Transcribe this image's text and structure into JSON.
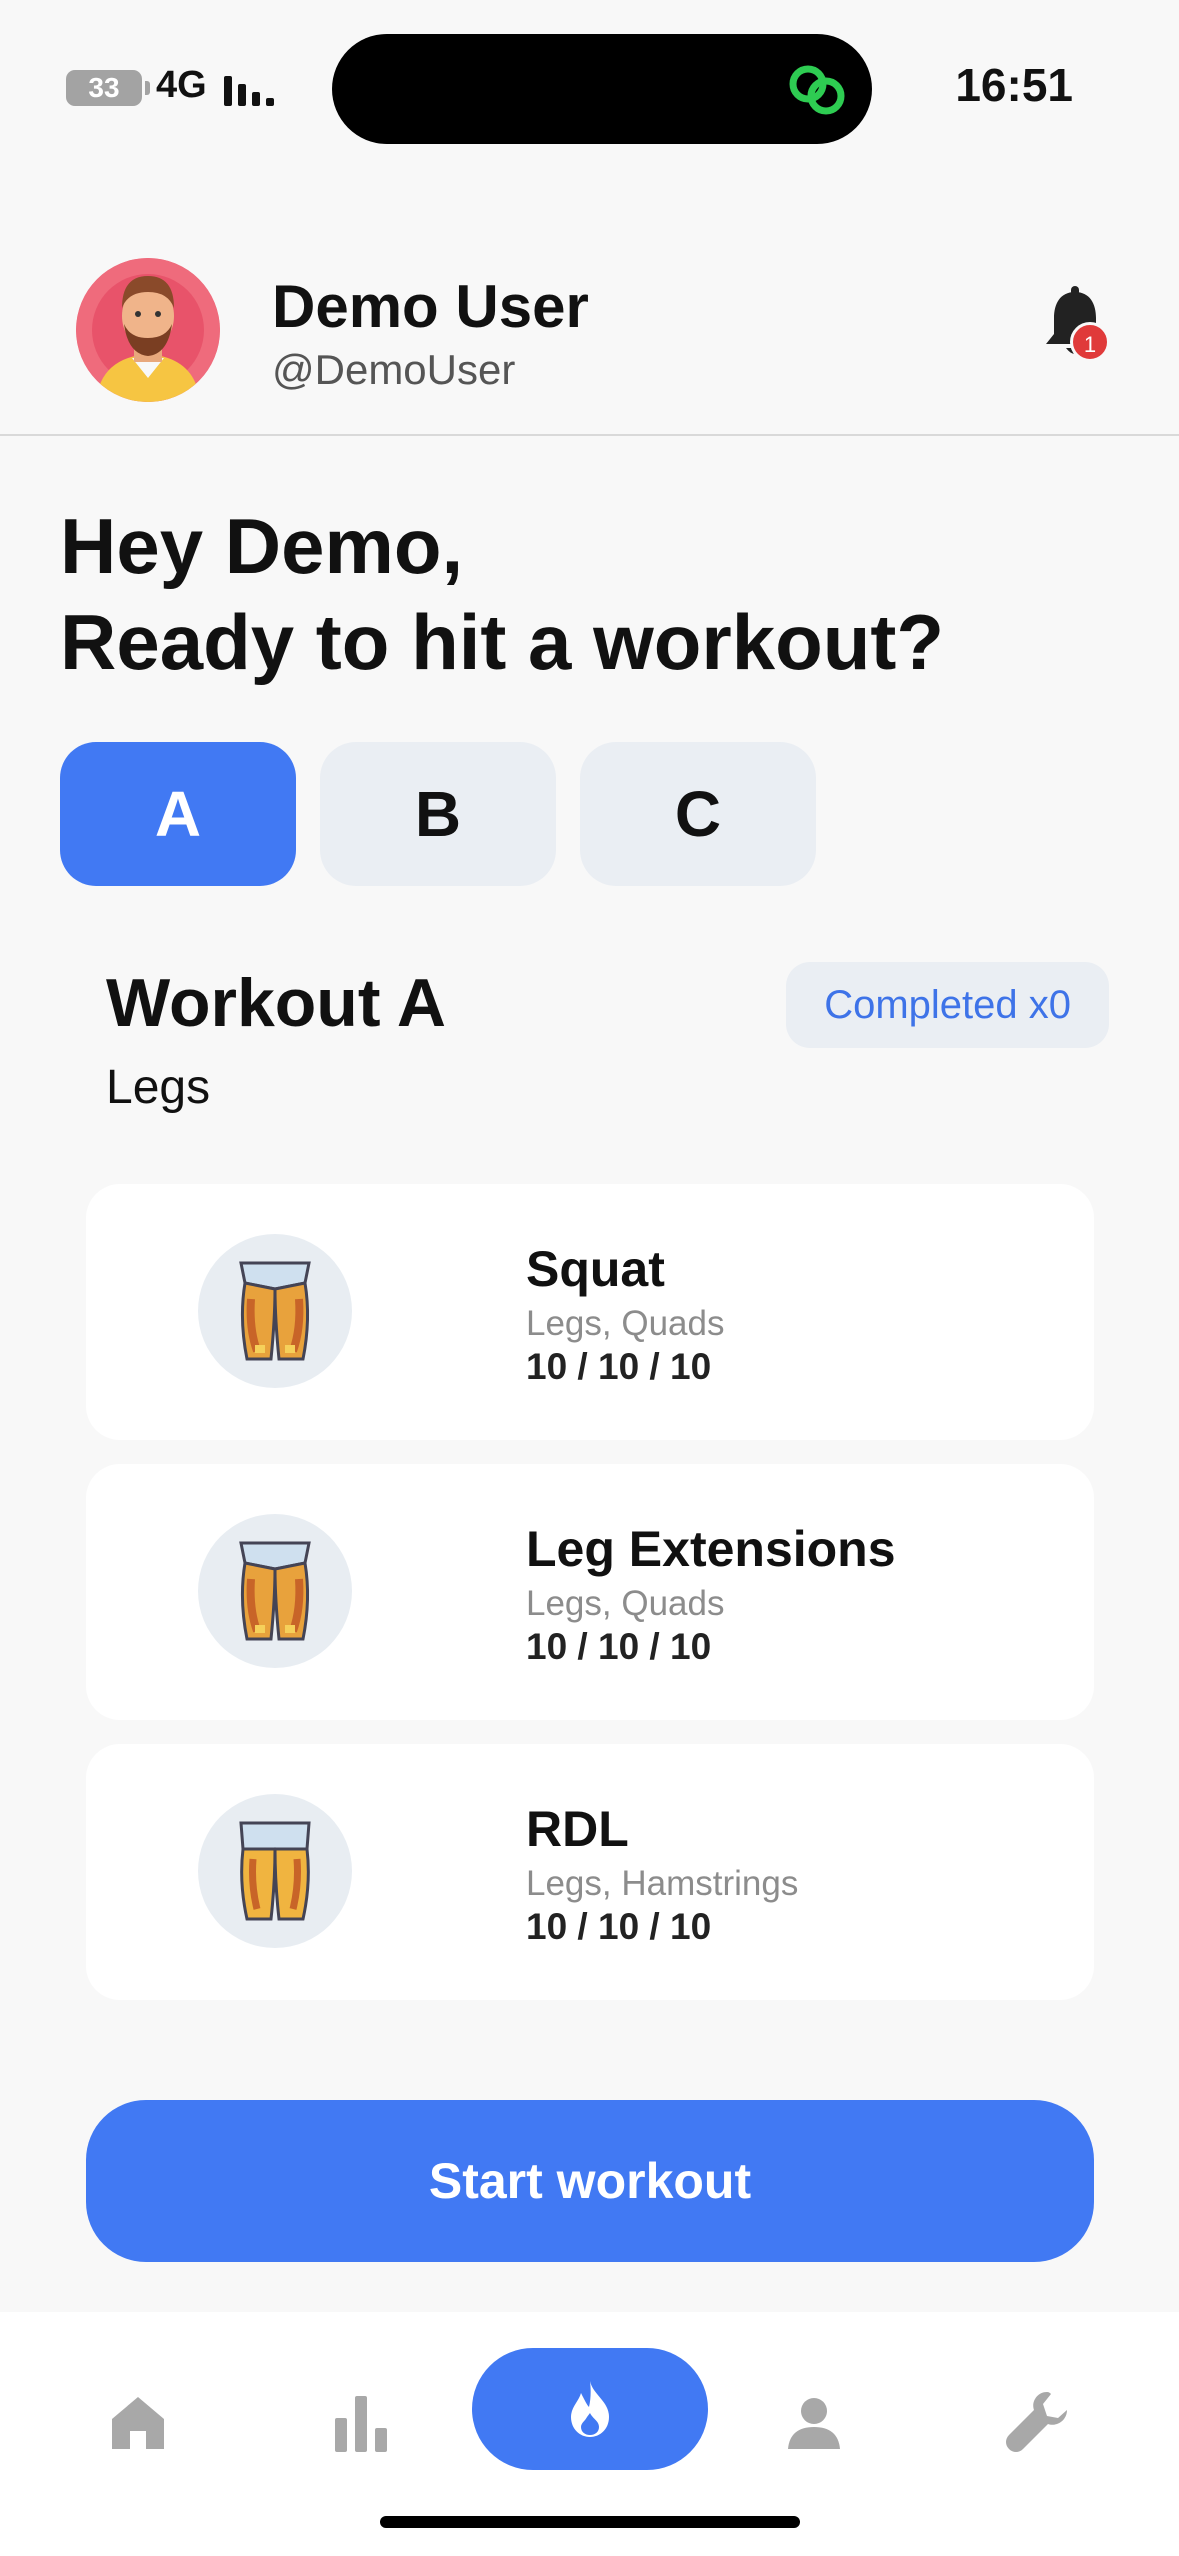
{
  "status_bar": {
    "battery": "33",
    "network": "4G",
    "time": "16:51"
  },
  "header": {
    "user_name": "Demo User",
    "user_handle": "@DemoUser",
    "notification_count": "1",
    "icons": [
      "avatar",
      "bell-icon"
    ]
  },
  "greeting": {
    "line1": "Hey Demo,",
    "line2": "Ready to hit a workout?"
  },
  "tabs": [
    {
      "label": "A",
      "active": true
    },
    {
      "label": "B",
      "active": false
    },
    {
      "label": "C",
      "active": false
    }
  ],
  "workout": {
    "title": "Workout A",
    "subtitle": "Legs",
    "completed": "Completed x0"
  },
  "exercises": [
    {
      "name": "Squat",
      "muscles": "Legs, Quads",
      "sets": "10 / 10 / 10",
      "icon": "legs-front-icon"
    },
    {
      "name": "Leg Extensions",
      "muscles": "Legs, Quads",
      "sets": "10 / 10 / 10",
      "icon": "legs-front-icon"
    },
    {
      "name": "RDL",
      "muscles": "Legs, Hamstrings",
      "sets": "10 / 10 / 10",
      "icon": "legs-back-icon"
    }
  ],
  "start_button": "Start workout",
  "bottom_nav": {
    "items": [
      "home-icon",
      "stats-icon",
      "flame-icon",
      "profile-icon",
      "wrench-icon"
    ],
    "active": "flame-icon"
  },
  "colors": {
    "accent": "#4179f3",
    "tab_inactive": "#eaeef3",
    "badge_red": "#e03a3a",
    "background": "#f8f8f8"
  }
}
